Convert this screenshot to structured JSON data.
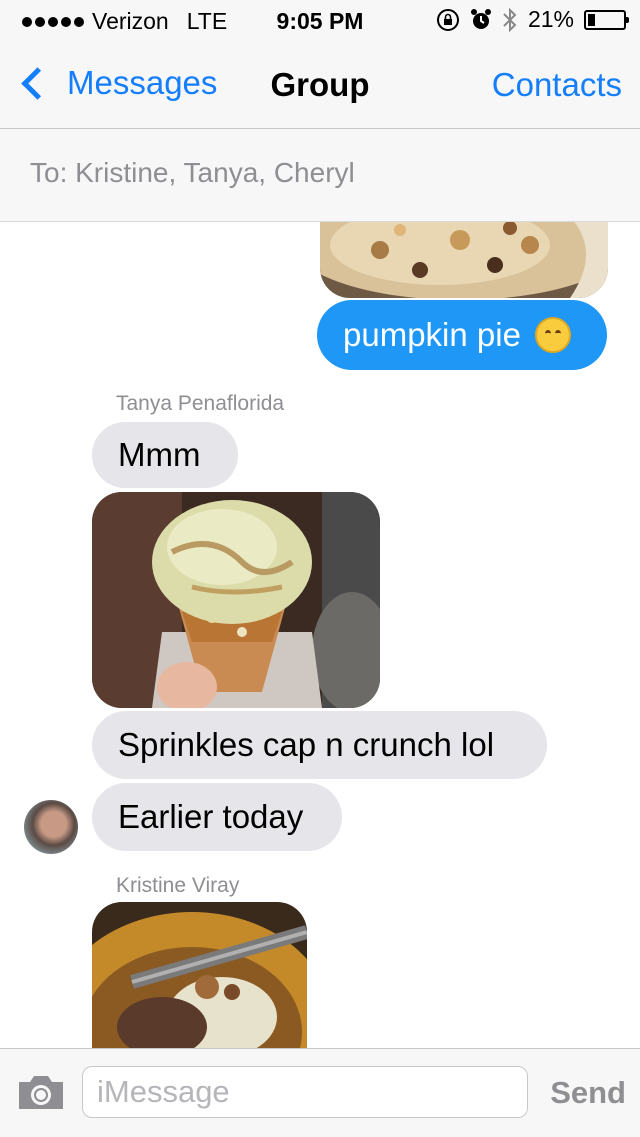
{
  "status_bar": {
    "carrier": "Verizon",
    "network": "LTE",
    "time": "9:05 PM",
    "battery": "21%",
    "battery_level": 0.21
  },
  "nav": {
    "back_label": "Messages",
    "title": "Group",
    "contacts_label": "Contacts"
  },
  "recipients": "To: Kristine, Tanya, Cheryl",
  "messages": [
    {
      "type": "photo",
      "from": "me"
    },
    {
      "type": "text",
      "from": "me",
      "text": "pumpkin pie"
    },
    {
      "type": "sender",
      "name": "Tanya Penaflorida"
    },
    {
      "type": "text",
      "from": "them",
      "text": "Mmm"
    },
    {
      "type": "photo",
      "from": "them"
    },
    {
      "type": "text",
      "from": "them",
      "text": "Sprinkles cap n crunch lol"
    },
    {
      "type": "text",
      "from": "them",
      "text": "Earlier today"
    },
    {
      "type": "sender",
      "name": "Kristine Viray"
    },
    {
      "type": "photo",
      "from": "them"
    }
  ],
  "compose": {
    "placeholder": "iMessage",
    "send_label": "Send"
  },
  "colors": {
    "accent": "#157efb",
    "outgoing_bubble": "#1e97f7",
    "incoming_bubble": "#e5e5ea"
  }
}
